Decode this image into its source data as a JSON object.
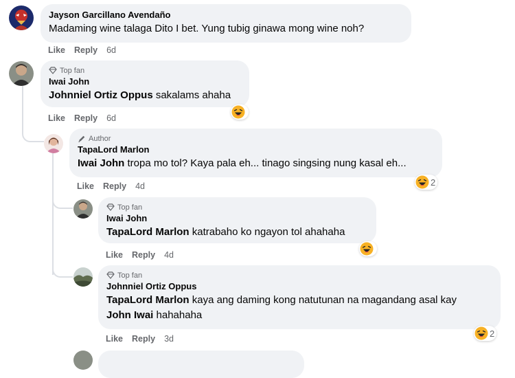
{
  "colors": {
    "bubble": "#f0f2f5",
    "meta": "#65676b",
    "text": "#050505",
    "thread_line": "#dcdfe4"
  },
  "comments": [
    {
      "author": "Jayson Garcillano Avendaño",
      "text": "Madaming wine talaga Dito I bet. Yung tubig ginawa mong wine noh?",
      "actions": {
        "like": "Like",
        "reply": "Reply",
        "time": "6d"
      }
    },
    {
      "badge": "Top fan",
      "author": "Iwai John",
      "mention": "Johnniel Ortiz Oppus",
      "text": " sakalams ahaha",
      "actions": {
        "like": "Like",
        "reply": "Reply",
        "time": "6d"
      },
      "reaction": {
        "icon": "haha-icon",
        "count": ""
      }
    },
    {
      "badge": "Author",
      "author": "TapaLord Marlon",
      "mention": "Iwai John",
      "text": " tropa mo tol? Kaya pala eh... tinago singsing nung kasal eh...",
      "actions": {
        "like": "Like",
        "reply": "Reply",
        "time": "4d"
      },
      "reaction": {
        "icon": "haha-icon",
        "count": "2"
      }
    },
    {
      "badge": "Top fan",
      "author": "Iwai John",
      "mention": "TapaLord Marlon",
      "text": " katrabaho ko ngayon tol ahahaha",
      "actions": {
        "like": "Like",
        "reply": "Reply",
        "time": "4d"
      },
      "reaction": {
        "icon": "haha-icon",
        "count": ""
      }
    },
    {
      "badge": "Top fan",
      "author": "Johnniel Ortiz Oppus",
      "mention": "TapaLord Marlon",
      "text": " kaya ang daming kong natutunan na magandang asal kay",
      "mention2": "John Iwai",
      "text2": " hahahaha",
      "actions": {
        "like": "Like",
        "reply": "Reply",
        "time": "3d"
      },
      "reaction": {
        "icon": "haha-icon",
        "count": "2"
      }
    }
  ]
}
